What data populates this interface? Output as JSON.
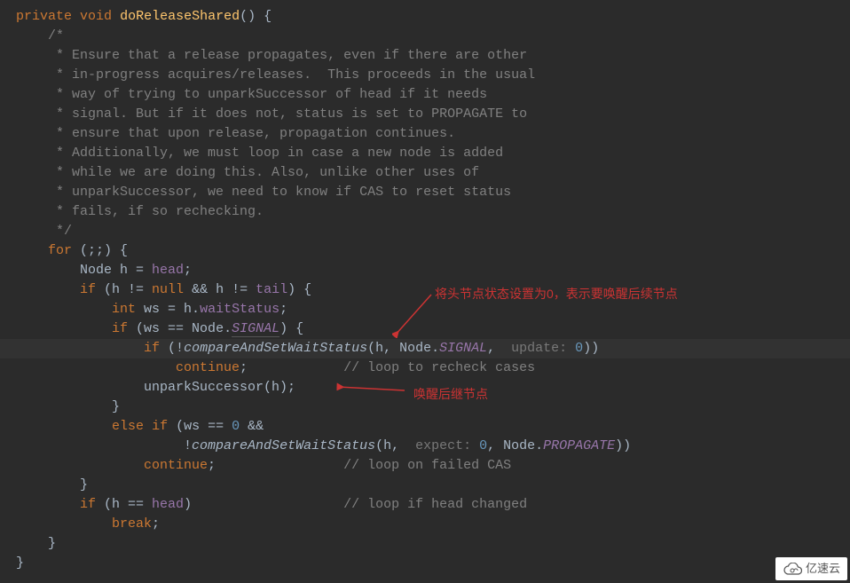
{
  "code": {
    "l1_private": "private",
    "l1_void": "void",
    "l1_method": "doReleaseShared",
    "l1_rest": "() {",
    "l2": "/*",
    "l3": " * Ensure that a release propagates, even if there are other",
    "l4": " * in-progress acquires/releases.  This proceeds in the usual",
    "l5": " * way of trying to unparkSuccessor of head if it needs",
    "l6": " * signal. But if it does not, status is set to PROPAGATE to",
    "l7": " * ensure that upon release, propagation continues.",
    "l8": " * Additionally, we must loop in case a new node is added",
    "l9": " * while we are doing this. Also, unlike other uses of",
    "l10": " * unparkSuccessor, we need to know if CAS to reset status",
    "l11": " * fails, if so rechecking.",
    "l12": " */",
    "l13_for": "for",
    "l13_rest": " (;;) {",
    "l14_pre": "Node h = ",
    "l14_head": "head",
    "l14_post": ";",
    "l15_if": "if",
    "l15_a": " (h != ",
    "l15_null": "null",
    "l15_b": " && h != ",
    "l15_tail": "tail",
    "l15_c": ") {",
    "l16_int": "int",
    "l16_a": " ws = h.",
    "l16_ws": "waitStatus",
    "l16_b": ";",
    "l17_if": "if",
    "l17_a": " (ws == Node.",
    "l17_sig": "SIGNAL",
    "l17_b": ") {",
    "l18_if": "if",
    "l18_a": " (!",
    "l18_cas": "compareAndSetWaitStatus",
    "l18_b": "(h, Node.",
    "l18_sig": "SIGNAL",
    "l18_c": ", ",
    "l18_hint": " update: ",
    "l18_zero": "0",
    "l18_d": "))",
    "l19_cont": "continue",
    "l19_a": ";",
    "l19_cmt": "// loop to recheck cases",
    "l20_a": "unparkSuccessor(h);",
    "l21": "}",
    "l22_else": "else",
    "l22_if": "if",
    "l22_a": " (ws == ",
    "l22_zero": "0",
    "l22_b": " &&",
    "l23_a": "!",
    "l23_cas": "compareAndSetWaitStatus",
    "l23_b": "(h, ",
    "l23_hint": " expect: ",
    "l23_zero": "0",
    "l23_c": ", Node.",
    "l23_prop": "PROPAGATE",
    "l23_d": "))",
    "l24_cont": "continue",
    "l24_a": ";",
    "l24_cmt": "// loop on failed CAS",
    "l25": "}",
    "l26_if": "if",
    "l26_a": " (h == ",
    "l26_head": "head",
    "l26_b": ")",
    "l26_cmt": "// loop if head changed",
    "l27_break": "break",
    "l27_a": ";",
    "l28": "}",
    "l29": "}"
  },
  "annotations": {
    "a1": "将头节点状态设置为0，表示要唤醒后续节点",
    "a2": "唤醒后继节点"
  },
  "watermark": {
    "text": "亿速云"
  }
}
